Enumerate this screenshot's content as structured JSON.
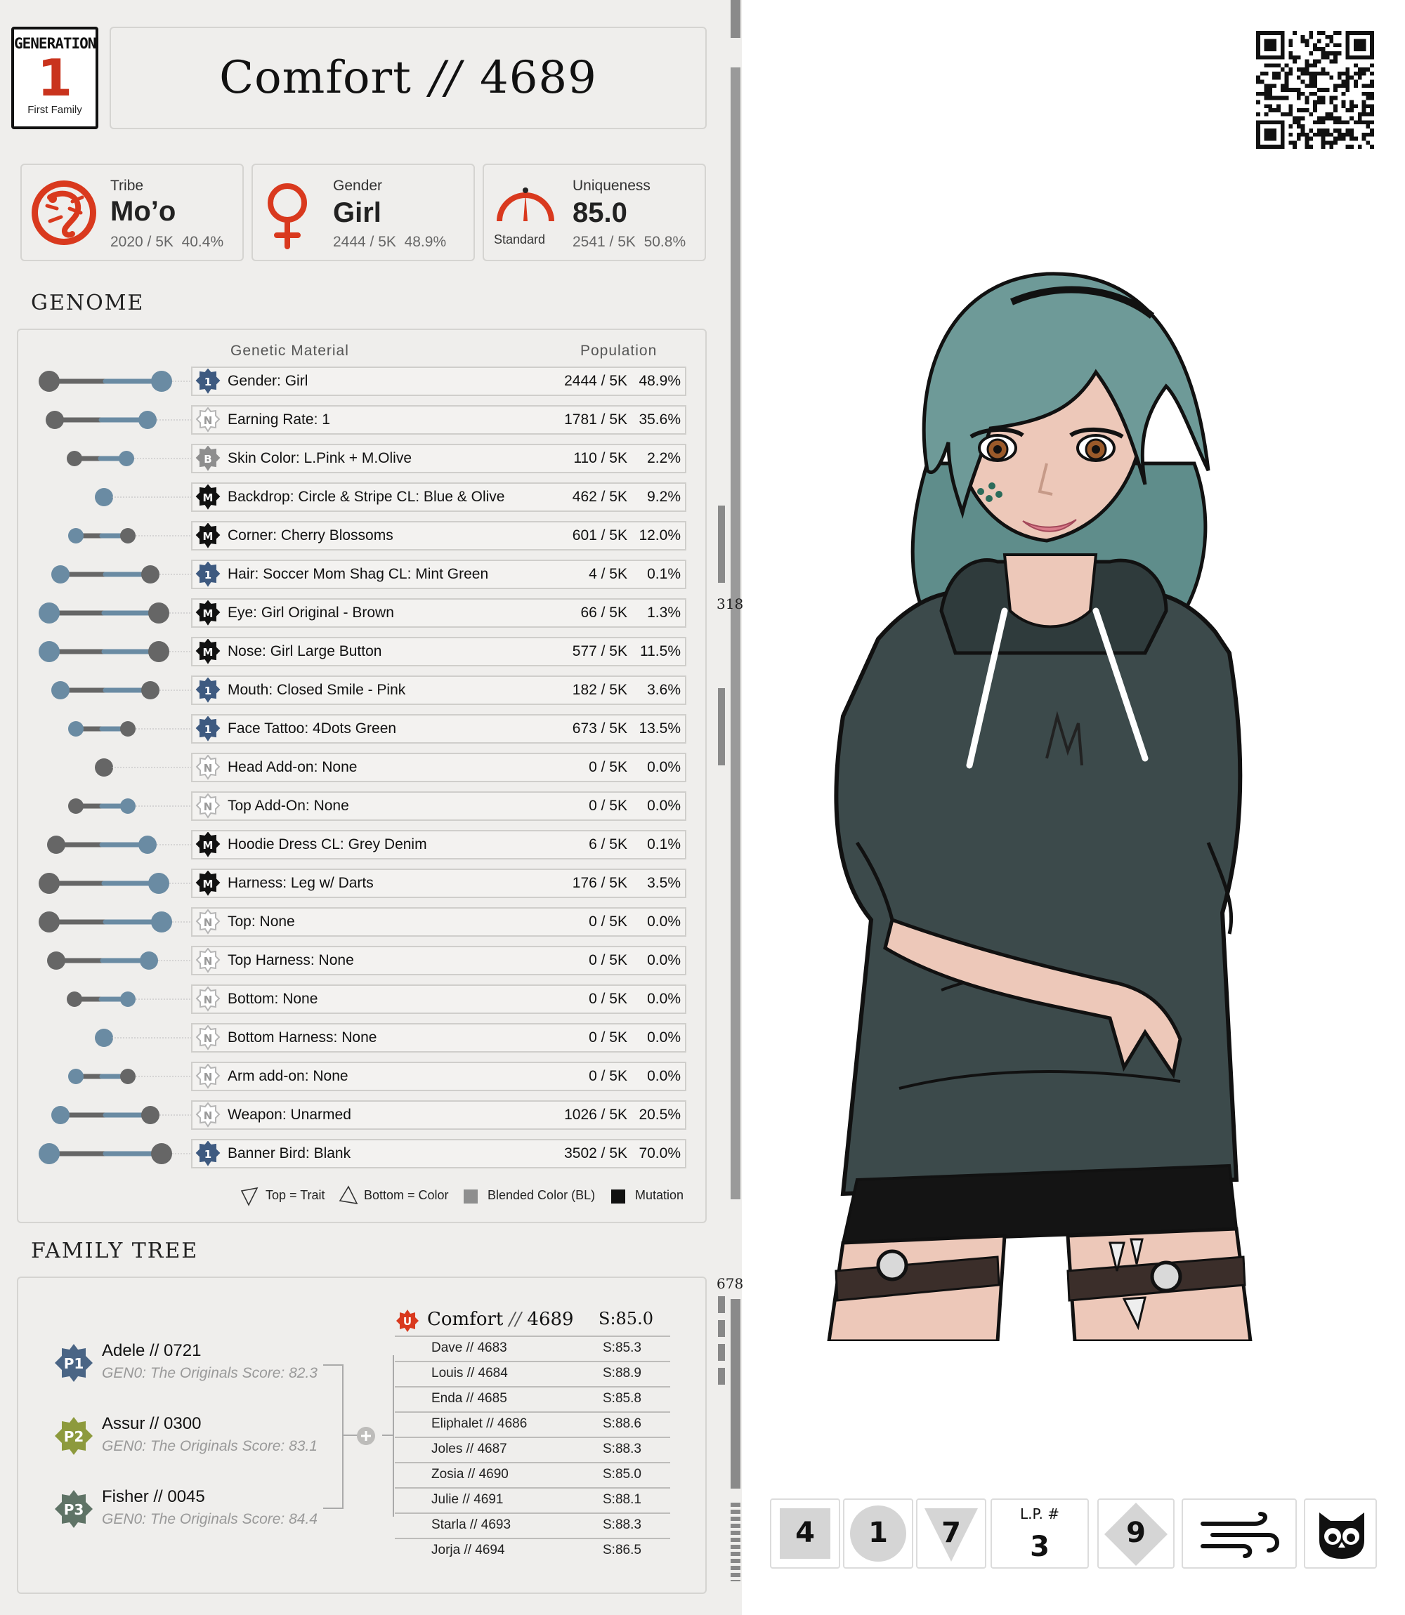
{
  "generation": {
    "label": "GENERATION",
    "number": "1",
    "sub": "First Family"
  },
  "title": {
    "name": "Comfort",
    "sep": "//",
    "id": "4689"
  },
  "tribe": {
    "label": "Tribe",
    "value": "Mo’o",
    "count": "2020 / 5K",
    "pct": "40.4%"
  },
  "gender": {
    "label": "Gender",
    "value": "Girl",
    "count": "2444 / 5K",
    "pct": "48.9%"
  },
  "uniqueness": {
    "label": "Uniqueness",
    "value": "85.0",
    "badge_label": "Standard",
    "count": "2541 / 5K",
    "pct": "50.8%"
  },
  "genome": {
    "section_title": "GENOME",
    "col_material": "Genetic Material",
    "col_population": "Population",
    "rows": [
      {
        "badge": "1",
        "name": "Gender: Girl",
        "count": "2444 / 5K",
        "pct": "48.9%"
      },
      {
        "badge": "N",
        "name": "Earning Rate: 1",
        "count": "1781 / 5K",
        "pct": "35.6%"
      },
      {
        "badge": "B",
        "name": "Skin Color: L.Pink + M.Olive",
        "count": "110 / 5K",
        "pct": "2.2%"
      },
      {
        "badge": "M",
        "name": "Backdrop: Circle & Stripe CL: Blue & Olive",
        "count": "462 / 5K",
        "pct": "9.2%"
      },
      {
        "badge": "M",
        "name": "Corner: Cherry Blossoms",
        "count": "601 / 5K",
        "pct": "12.0%"
      },
      {
        "badge": "1",
        "name": "Hair: Soccer Mom Shag CL: Mint Green",
        "count": "4 / 5K",
        "pct": "0.1%"
      },
      {
        "badge": "M",
        "name": "Eye: Girl Original - Brown",
        "count": "66 / 5K",
        "pct": "1.3%"
      },
      {
        "badge": "M",
        "name": "Nose: Girl Large Button",
        "count": "577 / 5K",
        "pct": "11.5%"
      },
      {
        "badge": "1",
        "name": "Mouth: Closed Smile - Pink",
        "count": "182 / 5K",
        "pct": "3.6%"
      },
      {
        "badge": "1",
        "name": "Face Tattoo: 4Dots Green",
        "count": "673 / 5K",
        "pct": "13.5%"
      },
      {
        "badge": "N",
        "name": "Head Add-on:  None",
        "count": "0 / 5K",
        "pct": "0.0%"
      },
      {
        "badge": "N",
        "name": "Top Add-On: None",
        "count": "0 / 5K",
        "pct": "0.0%"
      },
      {
        "badge": "M",
        "name": "Hoodie Dress CL: Grey Denim",
        "count": "6 / 5K",
        "pct": "0.1%"
      },
      {
        "badge": "M",
        "name": "Harness: Leg w/ Darts",
        "count": "176 / 5K",
        "pct": "3.5%"
      },
      {
        "badge": "N",
        "name": "Top: None",
        "count": "0 / 5K",
        "pct": "0.0%"
      },
      {
        "badge": "N",
        "name": "Top Harness: None",
        "count": "0 / 5K",
        "pct": "0.0%"
      },
      {
        "badge": "N",
        "name": "Bottom: None",
        "count": "0 / 5K",
        "pct": "0.0%"
      },
      {
        "badge": "N",
        "name": "Bottom Harness: None",
        "count": "0 / 5K",
        "pct": "0.0%"
      },
      {
        "badge": "N",
        "name": "Arm add-on: None",
        "count": "0 / 5K",
        "pct": "0.0%"
      },
      {
        "badge": "N",
        "name": "Weapon: Unarmed",
        "count": "1026 / 5K",
        "pct": "20.5%"
      },
      {
        "badge": "1",
        "name": "Banner Bird:  Blank",
        "count": "3502 / 5K",
        "pct": "70.0%"
      }
    ],
    "legend": {
      "top": "Top = Trait",
      "bottom": "Bottom = Color",
      "blended": "Blended Color (BL)",
      "mutation": "Mutation"
    }
  },
  "family": {
    "section_title": "FAMILY TREE",
    "parents": [
      {
        "badge": "P1",
        "name": "Adele  //  0721",
        "score": "GEN0: The Originals Score: 82.3",
        "color": "#4a6585"
      },
      {
        "badge": "P2",
        "name": "Assur  //  0300",
        "score": "GEN0: The Originals Score: 83.1",
        "color": "#8d9a3d"
      },
      {
        "badge": "P3",
        "name": "Fisher  //  0045",
        "score": "GEN0: The Originals Score: 84.4",
        "color": "#5f7366"
      }
    ],
    "self": {
      "badge": "U",
      "name": "Comfort",
      "sep": "//",
      "id": "4689",
      "score": "S:85.0"
    },
    "siblings": [
      {
        "name": "Dave  //  4683",
        "score": "S:85.3"
      },
      {
        "name": "Louis  //  4684",
        "score": "S:88.9"
      },
      {
        "name": "Enda  //  4685",
        "score": "S:85.8"
      },
      {
        "name": "Eliphalet  //  4686",
        "score": "S:88.6"
      },
      {
        "name": "Joles  //  4687",
        "score": "S:88.3"
      },
      {
        "name": "Zosia  //  4690",
        "score": "S:85.0"
      },
      {
        "name": "Julie  //  4691",
        "score": "S:88.1"
      },
      {
        "name": "Starla  //  4693",
        "score": "S:88.3"
      },
      {
        "name": "Jorja  //  4694",
        "score": "S:86.5"
      }
    ]
  },
  "side_numbers": {
    "upper": "318",
    "lower": "678"
  },
  "cards": [
    {
      "value": "4",
      "shape": "square"
    },
    {
      "value": "1",
      "shape": "circle"
    },
    {
      "value": "7",
      "shape": "triangle"
    },
    {
      "label": "L.P. #",
      "value": "3",
      "shape": "none"
    },
    {
      "value": "9",
      "shape": "diamond"
    },
    {
      "icon": "wind-icon"
    },
    {
      "icon": "owl-icon"
    }
  ],
  "colors": {
    "accent": "#d9391e",
    "blue_badge": "#3e5a80",
    "panel": "#efeeec",
    "hair": "#6e9a98",
    "hoodie": "#3c4a4b"
  }
}
